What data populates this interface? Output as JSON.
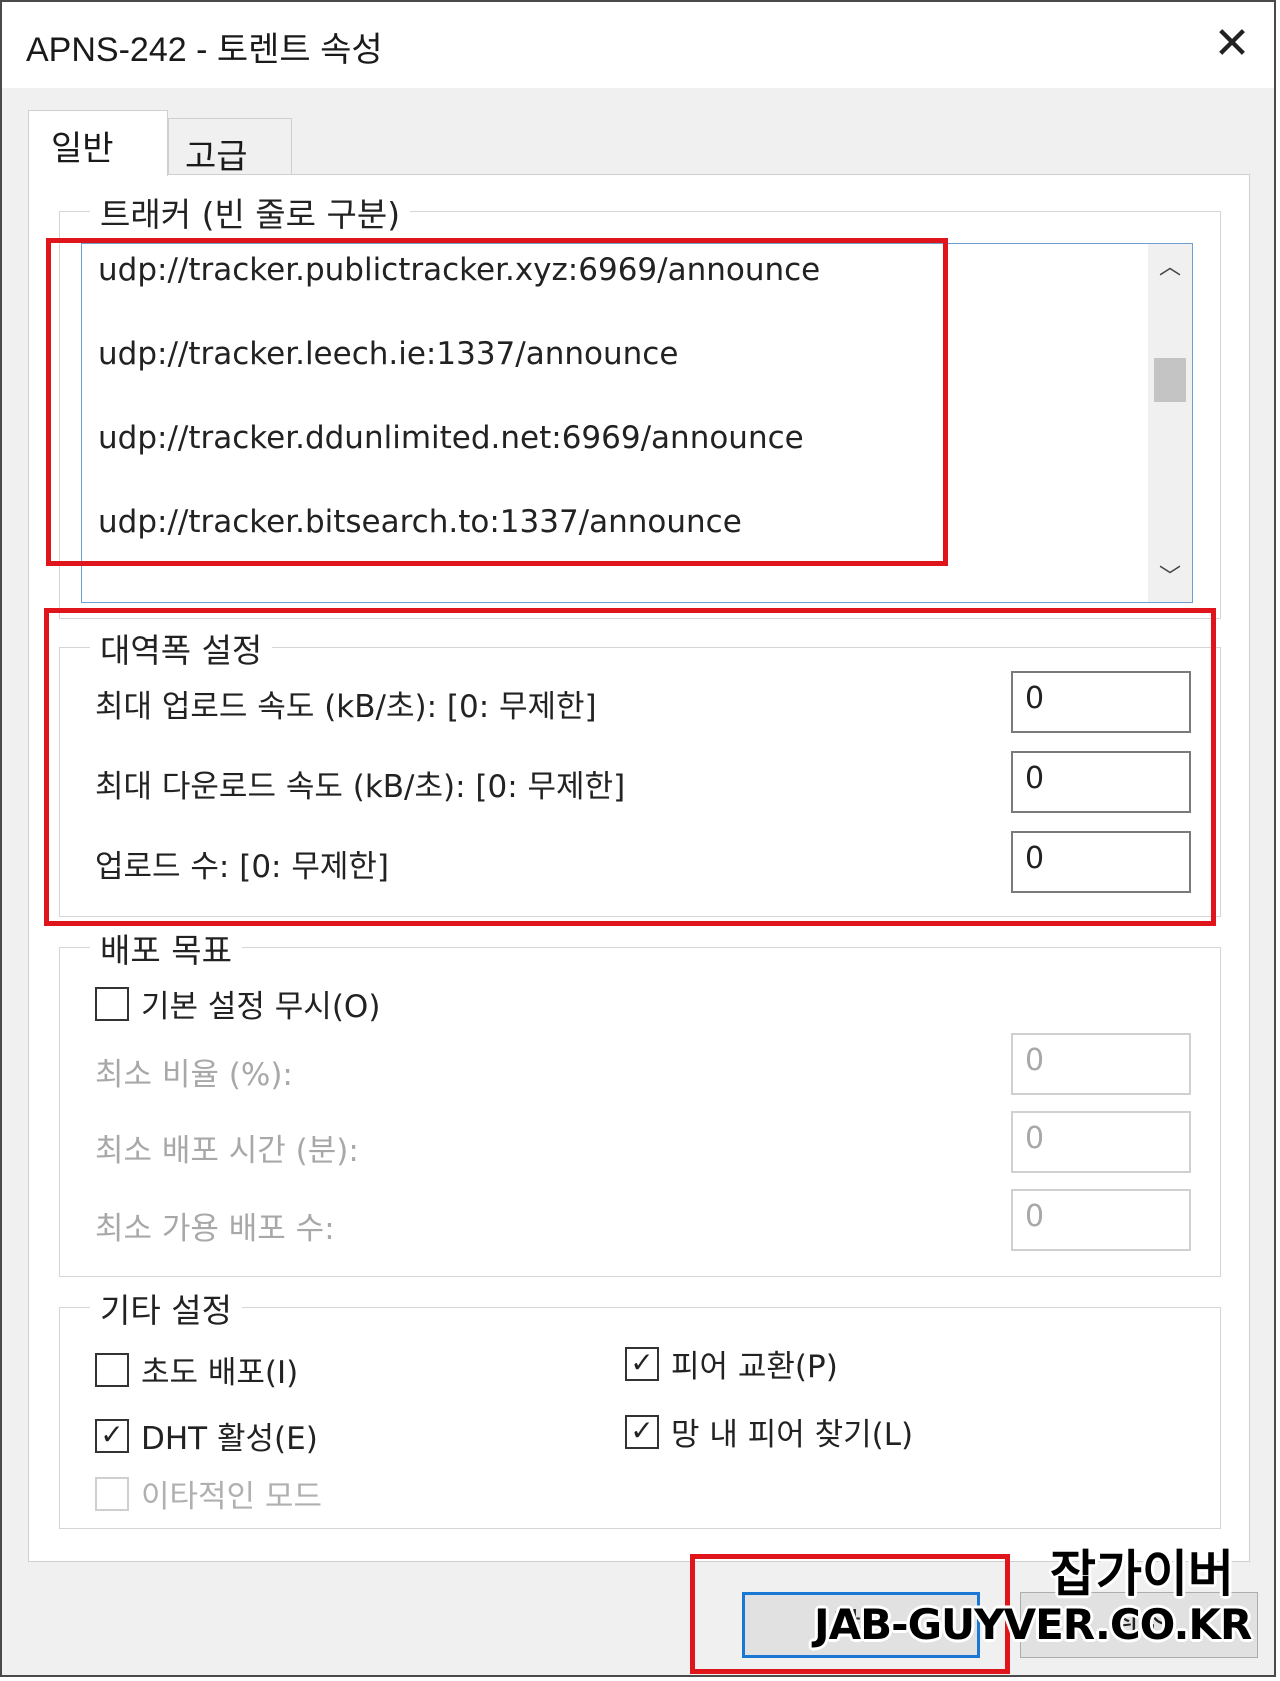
{
  "window": {
    "title": "APNS-242 - 토렌트 속성"
  },
  "tabs": [
    {
      "label": "일반",
      "active": true
    },
    {
      "label": "고급",
      "active": false
    }
  ],
  "trackers": {
    "label": "트래커 (빈 줄로 구분)",
    "lines": [
      "udp://tracker.publictracker.xyz:6969/announce",
      "udp://tracker.leech.ie:1337/announce",
      "udp://tracker.ddunlimited.net:6969/announce",
      "udp://tracker.bitsearch.to:1337/announce"
    ]
  },
  "bandwidth": {
    "label": "대역폭 설정",
    "rows": [
      {
        "label": "최대 업로드 속도 (kB/초): [0: 무제한]",
        "value": "0"
      },
      {
        "label": "최대 다운로드 속도 (kB/초): [0: 무제한]",
        "value": "0"
      },
      {
        "label": "업로드 수: [0: 무제한]",
        "value": "0"
      }
    ]
  },
  "seeding": {
    "label": "배포 목표",
    "override_label": "기본 설정 무시(O)",
    "override_checked": false,
    "rows": [
      {
        "label": "최소 비율 (%):",
        "value": "0"
      },
      {
        "label": "최소 배포 시간 (분):",
        "value": "0"
      },
      {
        "label": "최소 가용 배포 수:",
        "value": "0"
      }
    ]
  },
  "other": {
    "label": "기타 설정",
    "items": [
      {
        "label": "초도 배포(I)",
        "checked": false,
        "mark": ""
      },
      {
        "label": "피어 교환(P)",
        "checked": true,
        "mark": "✓"
      },
      {
        "label": "DHT 활성(E)",
        "checked": true,
        "mark": "✓"
      },
      {
        "label": "망 내 피어 찾기(L)",
        "checked": true,
        "mark": "✓"
      },
      {
        "label": "이타적인 모드",
        "checked": false,
        "mark": ""
      }
    ]
  },
  "buttons": {
    "ok": "확인",
    "cancel": "취소"
  },
  "watermark": {
    "korean": "잡가이버",
    "english": "JAB-GUYVER.CO.KR"
  },
  "colors": {
    "highlight": "#e0151b",
    "focus": "#1a78d4"
  }
}
